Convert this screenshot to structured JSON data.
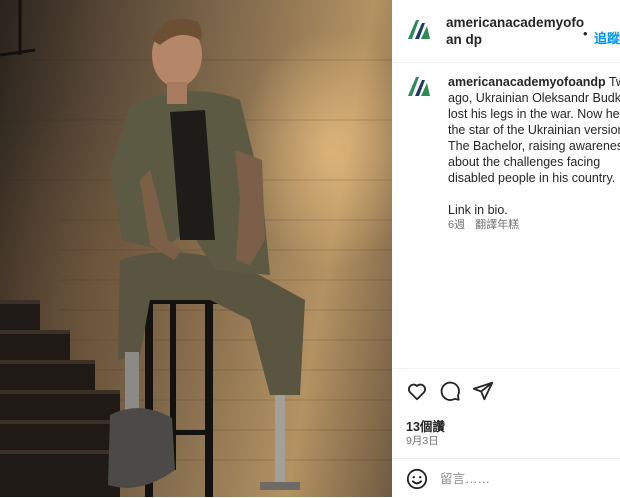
{
  "post": {
    "username": "americanacademyofoandp",
    "header_username_display": "americanacademyofoan dp",
    "follow_label": "追蹤",
    "caption_lines": [
      "americanacademyofoandp Two y",
      "ago, Ukrainian Oleksandr Budko",
      "lost his legs in the war. Now he",
      "the star of the Ukrainian version",
      "The Bachelor, raising awareness",
      "about the challenges facing",
      "disabled people in his country."
    ],
    "caption_user": "americanacademyofoandp",
    "link_in_bio": "Link in bio.",
    "age": "6週",
    "translate_label": "翻譯年糕",
    "likes": "13個讚",
    "date": "9月3日",
    "comment_placeholder": "留言……"
  },
  "icons": {
    "like": "heart-icon",
    "comment": "comment-bubble-icon",
    "share": "paper-plane-icon",
    "emoji": "smiley-icon",
    "logo": "academy-logo"
  },
  "colors": {
    "link_blue": "#0095f6",
    "logo_green": "#2e8b57",
    "logo_navy": "#1f3864",
    "secondary_text": "#737373"
  }
}
